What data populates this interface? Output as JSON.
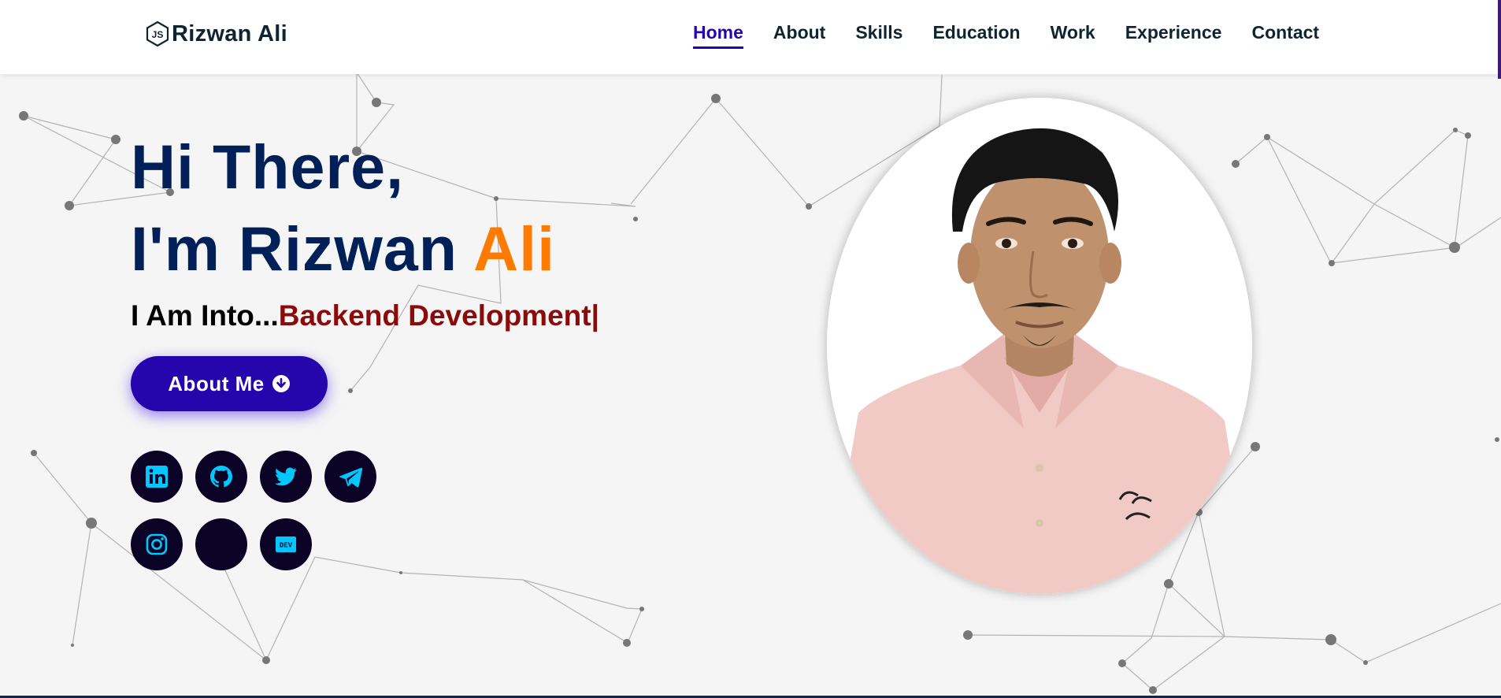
{
  "brand": {
    "name": "Rizwan Ali",
    "logo_icon": "js-hexagon-icon"
  },
  "nav": {
    "items": [
      {
        "label": "Home",
        "active": true
      },
      {
        "label": "About"
      },
      {
        "label": "Skills"
      },
      {
        "label": "Education"
      },
      {
        "label": "Work"
      },
      {
        "label": "Experience"
      },
      {
        "label": "Contact"
      }
    ],
    "active_color": "#2506ad"
  },
  "hero": {
    "greeting_line1": "Hi There,",
    "greeting_line2_prefix": "I'm Rizwan ",
    "greeting_line2_accent": "Ali",
    "typed_prefix": "I Am Into...",
    "typed_role": "Backend Development|",
    "button_label": "About Me",
    "button_icon": "arrow-circle-down-icon"
  },
  "socials": [
    {
      "name": "linkedin",
      "icon": "linkedin-icon"
    },
    {
      "name": "github",
      "icon": "github-icon"
    },
    {
      "name": "twitter",
      "icon": "twitter-icon"
    },
    {
      "name": "telegram",
      "icon": "telegram-icon"
    },
    {
      "name": "instagram",
      "icon": "instagram-icon"
    },
    {
      "name": "blank",
      "icon": ""
    },
    {
      "name": "dev",
      "icon": "dev-icon",
      "label": "DEV"
    }
  ],
  "colors": {
    "heading": "#002057",
    "accent_orange": "#ff7a00",
    "role_red": "#8b0b0b",
    "button": "#2506ad",
    "social_bg": "#0b0326",
    "social_icon": "#00c8ff",
    "background": "#f5f5f5"
  }
}
